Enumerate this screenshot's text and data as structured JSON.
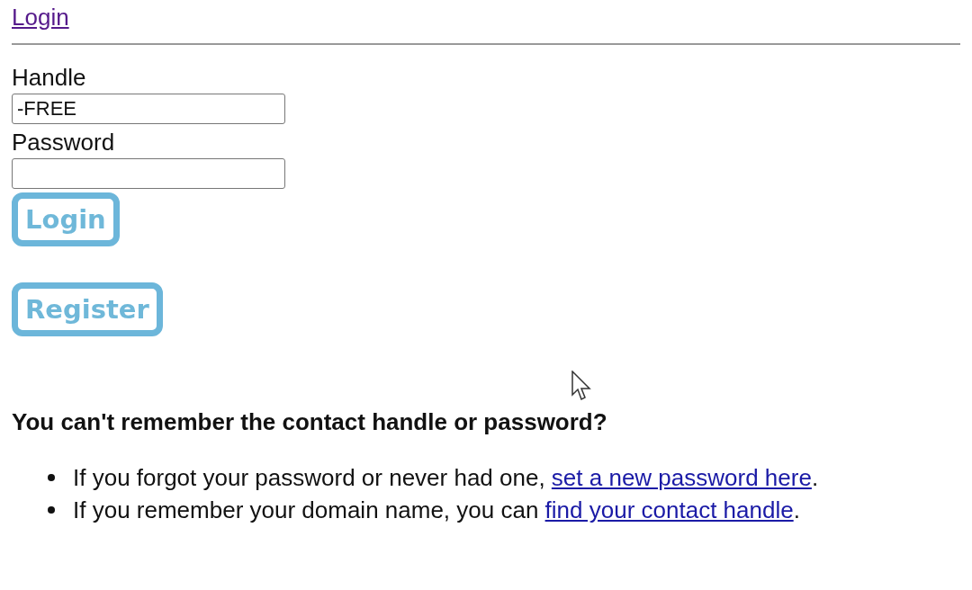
{
  "header_link": "Login",
  "fields": [
    {
      "label": "Handle",
      "value": "-FREE"
    },
    {
      "label": "Password"
    }
  ],
  "buttons": [
    "Login",
    "Register"
  ],
  "help": {
    "heading": "You can't remember the contact handle or password?",
    "items": [
      {
        "text": "If you forgot your password or never had one, ",
        "link": "set a new password here",
        "after": "."
      },
      {
        "text": "If you remember your domain name, you can ",
        "link": "find your contact handle",
        "after": "."
      }
    ]
  }
}
